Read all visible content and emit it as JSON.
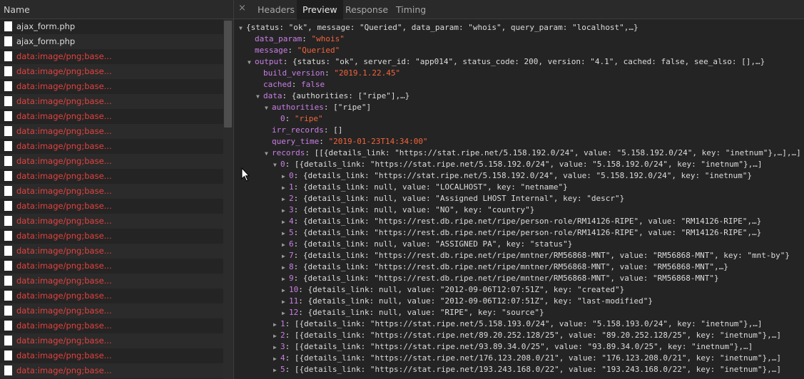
{
  "list_header": "Name",
  "requests": [
    {
      "name": "ajax_form.php",
      "error": false
    },
    {
      "name": "ajax_form.php",
      "error": false
    },
    {
      "name": "data:image/png;base...",
      "error": true
    },
    {
      "name": "data:image/png;base...",
      "error": true
    },
    {
      "name": "data:image/png;base...",
      "error": true
    },
    {
      "name": "data:image/png;base...",
      "error": true
    },
    {
      "name": "data:image/png;base...",
      "error": true
    },
    {
      "name": "data:image/png;base...",
      "error": true
    },
    {
      "name": "data:image/png;base...",
      "error": true
    },
    {
      "name": "data:image/png;base...",
      "error": true
    },
    {
      "name": "data:image/png;base...",
      "error": true
    },
    {
      "name": "data:image/png;base...",
      "error": true
    },
    {
      "name": "data:image/png;base...",
      "error": true
    },
    {
      "name": "data:image/png;base...",
      "error": true
    },
    {
      "name": "data:image/png;base...",
      "error": true
    },
    {
      "name": "data:image/png;base...",
      "error": true
    },
    {
      "name": "data:image/png;base...",
      "error": true
    },
    {
      "name": "data:image/png;base...",
      "error": true
    },
    {
      "name": "data:image/png;base...",
      "error": true
    },
    {
      "name": "data:image/png;base...",
      "error": true
    },
    {
      "name": "data:image/png;base...",
      "error": true
    },
    {
      "name": "data:image/png;base...",
      "error": true
    },
    {
      "name": "data:image/png;base...",
      "error": true
    },
    {
      "name": "data:image/png;base...",
      "error": true
    },
    {
      "name": "data:image/png;base...",
      "error": true
    }
  ],
  "tabs": {
    "close": "×",
    "items": [
      "Headers",
      "Preview",
      "Response",
      "Timing"
    ],
    "active": "Preview"
  },
  "preview_lines": [
    {
      "indent": 0,
      "tri": "down",
      "segs": [
        [
          "p",
          "{status: \"ok\", message: \"Queried\", data_param: \"whois\", query_param: \"localhost\",…}"
        ]
      ]
    },
    {
      "indent": 1,
      "tri": "none",
      "segs": [
        [
          "k",
          "data_param"
        ],
        [
          "p",
          ": "
        ],
        [
          "s",
          "\"whois\""
        ]
      ]
    },
    {
      "indent": 1,
      "tri": "none",
      "segs": [
        [
          "k",
          "message"
        ],
        [
          "p",
          ": "
        ],
        [
          "s",
          "\"Queried\""
        ]
      ]
    },
    {
      "indent": 1,
      "tri": "down",
      "segs": [
        [
          "k",
          "output"
        ],
        [
          "p",
          ": {status: \"ok\", server_id: \"app014\", status_code: 200, version: \"4.1\", cached: false, see_also: [],…}"
        ]
      ]
    },
    {
      "indent": 2,
      "tri": "none",
      "segs": [
        [
          "k",
          "build_version"
        ],
        [
          "p",
          ": "
        ],
        [
          "s",
          "\"2019.1.22.45\""
        ]
      ]
    },
    {
      "indent": 2,
      "tri": "none",
      "segs": [
        [
          "k",
          "cached"
        ],
        [
          "p",
          ": "
        ],
        [
          "kw",
          "false"
        ]
      ]
    },
    {
      "indent": 2,
      "tri": "down",
      "segs": [
        [
          "k",
          "data"
        ],
        [
          "p",
          ": {authorities: [\"ripe\"],…}"
        ]
      ]
    },
    {
      "indent": 3,
      "tri": "down",
      "segs": [
        [
          "k",
          "authorities"
        ],
        [
          "p",
          ": [\"ripe\"]"
        ]
      ]
    },
    {
      "indent": 4,
      "tri": "none",
      "segs": [
        [
          "k",
          "0"
        ],
        [
          "p",
          ": "
        ],
        [
          "s",
          "\"ripe\""
        ]
      ]
    },
    {
      "indent": 3,
      "tri": "none",
      "segs": [
        [
          "k",
          "irr_records"
        ],
        [
          "p",
          ": []"
        ]
      ]
    },
    {
      "indent": 3,
      "tri": "none",
      "segs": [
        [
          "k",
          "query_time"
        ],
        [
          "p",
          ": "
        ],
        [
          "s",
          "\"2019-01-23T14:34:00\""
        ]
      ]
    },
    {
      "indent": 3,
      "tri": "down",
      "segs": [
        [
          "k",
          "records"
        ],
        [
          "p",
          ": [[{details_link: \"https://stat.ripe.net/5.158.192.0/24\", value: \"5.158.192.0/24\", key: \"inetnum\"},…],…]"
        ]
      ]
    },
    {
      "indent": 4,
      "tri": "down",
      "segs": [
        [
          "k",
          "0"
        ],
        [
          "p",
          ": [{details_link: \"https://stat.ripe.net/5.158.192.0/24\", value: \"5.158.192.0/24\", key: \"inetnum\"},…]"
        ]
      ]
    },
    {
      "indent": 5,
      "tri": "right",
      "segs": [
        [
          "k",
          "0"
        ],
        [
          "p",
          ": {details_link: \"https://stat.ripe.net/5.158.192.0/24\", value: \"5.158.192.0/24\", key: \"inetnum\"}"
        ]
      ]
    },
    {
      "indent": 5,
      "tri": "right",
      "segs": [
        [
          "k",
          "1"
        ],
        [
          "p",
          ": {details_link: null, value: \"LOCALHOST\", key: \"netname\"}"
        ]
      ]
    },
    {
      "indent": 5,
      "tri": "right",
      "segs": [
        [
          "k",
          "2"
        ],
        [
          "p",
          ": {details_link: null, value: \"Assigned LHOST Internal\", key: \"descr\"}"
        ]
      ]
    },
    {
      "indent": 5,
      "tri": "right",
      "segs": [
        [
          "k",
          "3"
        ],
        [
          "p",
          ": {details_link: null, value: \"NO\", key: \"country\"}"
        ]
      ]
    },
    {
      "indent": 5,
      "tri": "right",
      "segs": [
        [
          "k",
          "4"
        ],
        [
          "p",
          ": {details_link: \"https://rest.db.ripe.net/ripe/person-role/RM14126-RIPE\", value: \"RM14126-RIPE\",…}"
        ]
      ]
    },
    {
      "indent": 5,
      "tri": "right",
      "segs": [
        [
          "k",
          "5"
        ],
        [
          "p",
          ": {details_link: \"https://rest.db.ripe.net/ripe/person-role/RM14126-RIPE\", value: \"RM14126-RIPE\",…}"
        ]
      ]
    },
    {
      "indent": 5,
      "tri": "right",
      "segs": [
        [
          "k",
          "6"
        ],
        [
          "p",
          ": {details_link: null, value: \"ASSIGNED PA\", key: \"status\"}"
        ]
      ]
    },
    {
      "indent": 5,
      "tri": "right",
      "segs": [
        [
          "k",
          "7"
        ],
        [
          "p",
          ": {details_link: \"https://rest.db.ripe.net/ripe/mntner/RM56868-MNT\", value: \"RM56868-MNT\", key: \"mnt-by\"}"
        ]
      ]
    },
    {
      "indent": 5,
      "tri": "right",
      "segs": [
        [
          "k",
          "8"
        ],
        [
          "p",
          ": {details_link: \"https://rest.db.ripe.net/ripe/mntner/RM56868-MNT\", value: \"RM56868-MNT\",…}"
        ]
      ]
    },
    {
      "indent": 5,
      "tri": "right",
      "segs": [
        [
          "k",
          "9"
        ],
        [
          "p",
          ": {details_link: \"https://rest.db.ripe.net/ripe/mntner/RM56868-MNT\", value: \"RM56868-MNT\"}"
        ]
      ]
    },
    {
      "indent": 5,
      "tri": "right",
      "segs": [
        [
          "k",
          "10"
        ],
        [
          "p",
          ": {details_link: null, value: \"2012-09-06T12:07:51Z\", key: \"created\"}"
        ]
      ]
    },
    {
      "indent": 5,
      "tri": "right",
      "segs": [
        [
          "k",
          "11"
        ],
        [
          "p",
          ": {details_link: null, value: \"2012-09-06T12:07:51Z\", key: \"last-modified\"}"
        ]
      ]
    },
    {
      "indent": 5,
      "tri": "right",
      "segs": [
        [
          "k",
          "12"
        ],
        [
          "p",
          ": {details_link: null, value: \"RIPE\", key: \"source\"}"
        ]
      ]
    },
    {
      "indent": 4,
      "tri": "right",
      "segs": [
        [
          "k",
          "1"
        ],
        [
          "p",
          ": [{details_link: \"https://stat.ripe.net/5.158.193.0/24\", value: \"5.158.193.0/24\", key: \"inetnum\"},…]"
        ]
      ]
    },
    {
      "indent": 4,
      "tri": "right",
      "segs": [
        [
          "k",
          "2"
        ],
        [
          "p",
          ": [{details_link: \"https://stat.ripe.net/89.20.252.128/25\", value: \"89.20.252.128/25\", key: \"inetnum\"},…]"
        ]
      ]
    },
    {
      "indent": 4,
      "tri": "right",
      "segs": [
        [
          "k",
          "3"
        ],
        [
          "p",
          ": [{details_link: \"https://stat.ripe.net/93.89.34.0/25\", value: \"93.89.34.0/25\", key: \"inetnum\"},…]"
        ]
      ]
    },
    {
      "indent": 4,
      "tri": "right",
      "segs": [
        [
          "k",
          "4"
        ],
        [
          "p",
          ": [{details_link: \"https://stat.ripe.net/176.123.208.0/21\", value: \"176.123.208.0/21\", key: \"inetnum\"},…]"
        ]
      ]
    },
    {
      "indent": 4,
      "tri": "right",
      "segs": [
        [
          "k",
          "5"
        ],
        [
          "p",
          ": [{details_link: \"https://stat.ripe.net/193.243.168.0/22\", value: \"193.243.168.0/22\", key: \"inetnum\"},…]"
        ]
      ]
    }
  ],
  "colors": {
    "key": "#c97ee6",
    "string": "#f2643b",
    "error_text": "#e2423f"
  }
}
